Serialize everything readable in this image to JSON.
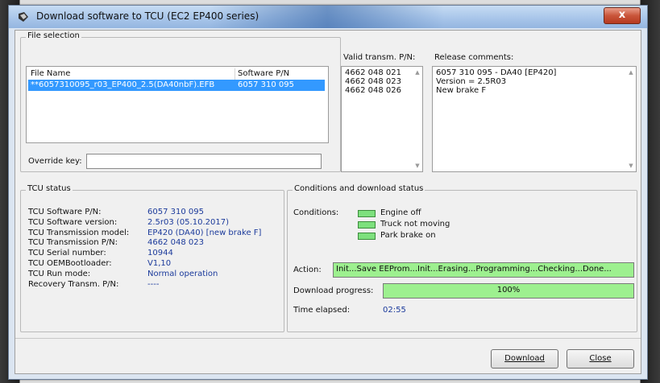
{
  "window": {
    "title": "Download software to TCU (EC2 EP400 series)",
    "close_glyph": "x"
  },
  "file_selection": {
    "legend": "File selection",
    "col_file": "File Name",
    "col_sw": "Software P/N",
    "row_file": "**6057310095_r03_EP400_2.5(DA40nbF).EFB",
    "row_sw": "6057 310 095",
    "override_label": "Override key:",
    "override_value": ""
  },
  "valid_pn": {
    "label": "Valid transm. P/N:",
    "items": [
      "4662 048 021",
      "4662 048 023",
      "4662 048 026"
    ]
  },
  "release": {
    "label": "Release comments:",
    "lines": [
      "6057 310 095 - DA40 [EP420]",
      "Version = 2.5R03",
      "New brake F"
    ]
  },
  "tcu_status": {
    "legend": "TCU status",
    "rows": [
      {
        "label": "TCU Software P/N:",
        "value": "6057 310 095"
      },
      {
        "label": "TCU Software version:",
        "value": "2.5r03 (05.10.2017)"
      },
      {
        "label": "TCU Transmission model:",
        "value": "EP420 (DA40) [new brake F]"
      },
      {
        "label": "TCU Transmission P/N:",
        "value": "4662 048 023"
      },
      {
        "label": "TCU Serial number:",
        "value": "10944"
      },
      {
        "label": "TCU OEMBootloader:",
        "value": "V1,10"
      },
      {
        "label": "TCU Run mode:",
        "value": "Normal operation"
      },
      {
        "label": "Recovery Transm. P/N:",
        "value": "----"
      }
    ]
  },
  "conditions": {
    "legend": "Conditions and download status",
    "label": "Conditions:",
    "items": [
      "Engine off",
      "Truck not moving",
      "Park brake on"
    ],
    "action_label": "Action:",
    "action_text": "Init...Save EEProm...Init...Erasing...Programming...Checking...Done...",
    "progress_label": "Download progress:",
    "progress_text": "100%",
    "progress_value": 1.0,
    "time_label": "Time elapsed:",
    "time_value": "02:55"
  },
  "buttons": {
    "download": "Download",
    "close": "Close"
  },
  "colors": {
    "indicator_green": "#7de07d",
    "progress_green": "#9df08f",
    "selection_blue": "#3399ff",
    "value_blue": "#1b3a9b"
  }
}
